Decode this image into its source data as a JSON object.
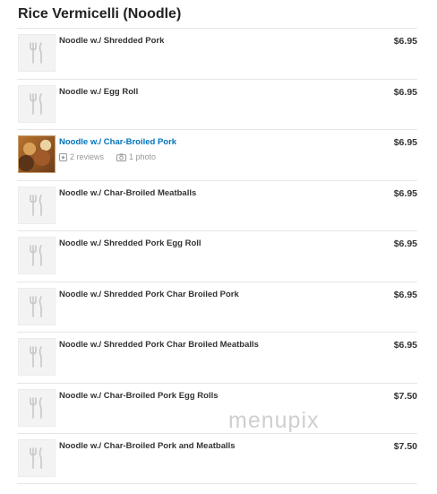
{
  "section": {
    "title": "Rice Vermicelli (Noodle)"
  },
  "items": [
    {
      "name": "Noodle w./ Shredded Pork",
      "price": "$6.95"
    },
    {
      "name": "Noodle w./ Egg Roll",
      "price": "$6.95"
    },
    {
      "name": "Noodle w./ Char-Broiled Pork",
      "price": "$6.95",
      "reviews": "2 reviews",
      "photos": "1 photo"
    },
    {
      "name": "Noodle w./ Char-Broiled Meatballs",
      "price": "$6.95"
    },
    {
      "name": "Noodle w./ Shredded Pork Egg Roll",
      "price": "$6.95"
    },
    {
      "name": "Noodle w./ Shredded Pork Char Broiled Pork",
      "price": "$6.95"
    },
    {
      "name": "Noodle w./ Shredded Pork Char Broiled Meatballs",
      "price": "$6.95"
    },
    {
      "name": "Noodle w./ Char-Broiled Pork Egg Rolls",
      "price": "$7.50"
    },
    {
      "name": "Noodle w./ Char-Broiled Pork and Meatballs",
      "price": "$7.50"
    }
  ],
  "watermark": "menupix",
  "colors": {
    "link": "#0073bb",
    "divider": "#e6e6e6",
    "text": "#333333",
    "muted": "#999999"
  },
  "icons": {
    "placeholder": "fork-knife-icon",
    "review": "review-icon",
    "photo": "camera-icon"
  }
}
